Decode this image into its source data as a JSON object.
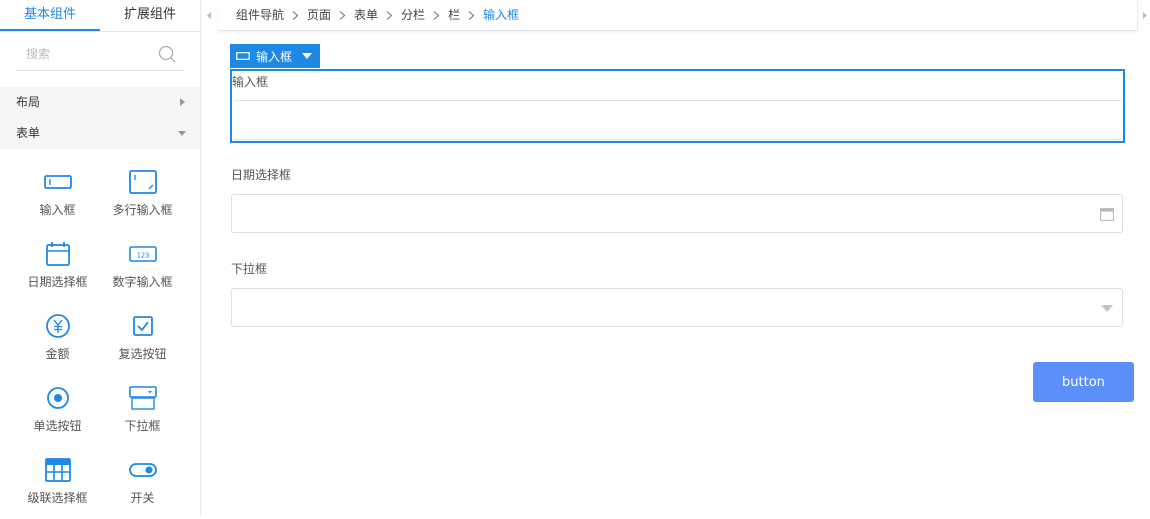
{
  "sidebar": {
    "tabs": [
      {
        "label": "基本组件",
        "active": true
      },
      {
        "label": "扩展组件",
        "active": false
      }
    ],
    "search": {
      "placeholder": "搜索",
      "value": ""
    },
    "categories": [
      {
        "label": "布局",
        "expanded": false
      },
      {
        "label": "表单",
        "expanded": true
      }
    ],
    "components": [
      {
        "label": "输入框",
        "icon": "input-icon"
      },
      {
        "label": "多行输入框",
        "icon": "textarea-icon"
      },
      {
        "label": "日期选择框",
        "icon": "calendar-icon"
      },
      {
        "label": "数字输入框",
        "icon": "number-input-icon"
      },
      {
        "label": "金额",
        "icon": "yen-icon"
      },
      {
        "label": "复选按钮",
        "icon": "checkbox-icon"
      },
      {
        "label": "单选按钮",
        "icon": "radio-icon"
      },
      {
        "label": "下拉框",
        "icon": "select-icon"
      },
      {
        "label": "级联选择框",
        "icon": "cascader-icon"
      },
      {
        "label": "开关",
        "icon": "switch-icon"
      }
    ]
  },
  "breadcrumb": [
    "组件导航",
    "页面",
    "表单",
    "分栏",
    "栏",
    "输入框"
  ],
  "canvas": {
    "selected_tag": "输入框",
    "fields": [
      {
        "label": "输入框",
        "value": ""
      },
      {
        "label": "日期选择框",
        "value": ""
      },
      {
        "label": "下拉框",
        "value": ""
      }
    ],
    "button_label": "button"
  },
  "colors": {
    "accent": "#1e88e5",
    "button": "#5b8ff9",
    "border": "#dcdfe6",
    "category_bg": "#f5f6f8"
  }
}
